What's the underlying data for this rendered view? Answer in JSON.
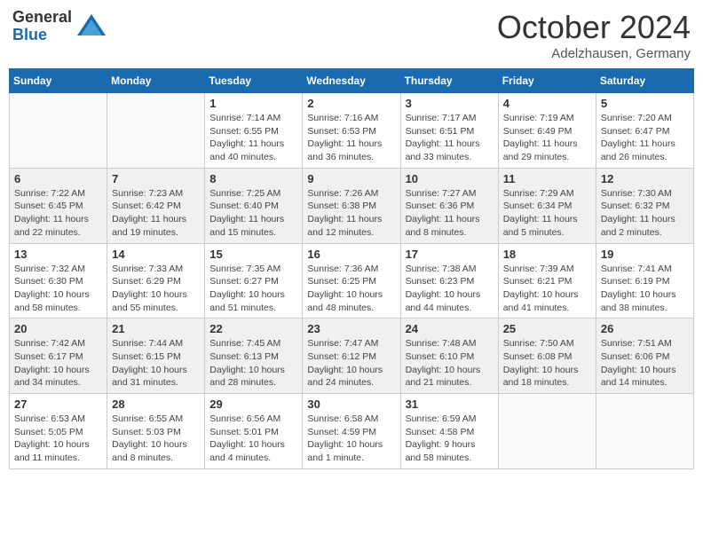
{
  "header": {
    "logo_general": "General",
    "logo_blue": "Blue",
    "month_year": "October 2024",
    "location": "Adelzhausen, Germany"
  },
  "days_of_week": [
    "Sunday",
    "Monday",
    "Tuesday",
    "Wednesday",
    "Thursday",
    "Friday",
    "Saturday"
  ],
  "weeks": [
    [
      {
        "day": "",
        "info": ""
      },
      {
        "day": "",
        "info": ""
      },
      {
        "day": "1",
        "info": "Sunrise: 7:14 AM\nSunset: 6:55 PM\nDaylight: 11 hours and 40 minutes."
      },
      {
        "day": "2",
        "info": "Sunrise: 7:16 AM\nSunset: 6:53 PM\nDaylight: 11 hours and 36 minutes."
      },
      {
        "day": "3",
        "info": "Sunrise: 7:17 AM\nSunset: 6:51 PM\nDaylight: 11 hours and 33 minutes."
      },
      {
        "day": "4",
        "info": "Sunrise: 7:19 AM\nSunset: 6:49 PM\nDaylight: 11 hours and 29 minutes."
      },
      {
        "day": "5",
        "info": "Sunrise: 7:20 AM\nSunset: 6:47 PM\nDaylight: 11 hours and 26 minutes."
      }
    ],
    [
      {
        "day": "6",
        "info": "Sunrise: 7:22 AM\nSunset: 6:45 PM\nDaylight: 11 hours and 22 minutes."
      },
      {
        "day": "7",
        "info": "Sunrise: 7:23 AM\nSunset: 6:42 PM\nDaylight: 11 hours and 19 minutes."
      },
      {
        "day": "8",
        "info": "Sunrise: 7:25 AM\nSunset: 6:40 PM\nDaylight: 11 hours and 15 minutes."
      },
      {
        "day": "9",
        "info": "Sunrise: 7:26 AM\nSunset: 6:38 PM\nDaylight: 11 hours and 12 minutes."
      },
      {
        "day": "10",
        "info": "Sunrise: 7:27 AM\nSunset: 6:36 PM\nDaylight: 11 hours and 8 minutes."
      },
      {
        "day": "11",
        "info": "Sunrise: 7:29 AM\nSunset: 6:34 PM\nDaylight: 11 hours and 5 minutes."
      },
      {
        "day": "12",
        "info": "Sunrise: 7:30 AM\nSunset: 6:32 PM\nDaylight: 11 hours and 2 minutes."
      }
    ],
    [
      {
        "day": "13",
        "info": "Sunrise: 7:32 AM\nSunset: 6:30 PM\nDaylight: 10 hours and 58 minutes."
      },
      {
        "day": "14",
        "info": "Sunrise: 7:33 AM\nSunset: 6:29 PM\nDaylight: 10 hours and 55 minutes."
      },
      {
        "day": "15",
        "info": "Sunrise: 7:35 AM\nSunset: 6:27 PM\nDaylight: 10 hours and 51 minutes."
      },
      {
        "day": "16",
        "info": "Sunrise: 7:36 AM\nSunset: 6:25 PM\nDaylight: 10 hours and 48 minutes."
      },
      {
        "day": "17",
        "info": "Sunrise: 7:38 AM\nSunset: 6:23 PM\nDaylight: 10 hours and 44 minutes."
      },
      {
        "day": "18",
        "info": "Sunrise: 7:39 AM\nSunset: 6:21 PM\nDaylight: 10 hours and 41 minutes."
      },
      {
        "day": "19",
        "info": "Sunrise: 7:41 AM\nSunset: 6:19 PM\nDaylight: 10 hours and 38 minutes."
      }
    ],
    [
      {
        "day": "20",
        "info": "Sunrise: 7:42 AM\nSunset: 6:17 PM\nDaylight: 10 hours and 34 minutes."
      },
      {
        "day": "21",
        "info": "Sunrise: 7:44 AM\nSunset: 6:15 PM\nDaylight: 10 hours and 31 minutes."
      },
      {
        "day": "22",
        "info": "Sunrise: 7:45 AM\nSunset: 6:13 PM\nDaylight: 10 hours and 28 minutes."
      },
      {
        "day": "23",
        "info": "Sunrise: 7:47 AM\nSunset: 6:12 PM\nDaylight: 10 hours and 24 minutes."
      },
      {
        "day": "24",
        "info": "Sunrise: 7:48 AM\nSunset: 6:10 PM\nDaylight: 10 hours and 21 minutes."
      },
      {
        "day": "25",
        "info": "Sunrise: 7:50 AM\nSunset: 6:08 PM\nDaylight: 10 hours and 18 minutes."
      },
      {
        "day": "26",
        "info": "Sunrise: 7:51 AM\nSunset: 6:06 PM\nDaylight: 10 hours and 14 minutes."
      }
    ],
    [
      {
        "day": "27",
        "info": "Sunrise: 6:53 AM\nSunset: 5:05 PM\nDaylight: 10 hours and 11 minutes."
      },
      {
        "day": "28",
        "info": "Sunrise: 6:55 AM\nSunset: 5:03 PM\nDaylight: 10 hours and 8 minutes."
      },
      {
        "day": "29",
        "info": "Sunrise: 6:56 AM\nSunset: 5:01 PM\nDaylight: 10 hours and 4 minutes."
      },
      {
        "day": "30",
        "info": "Sunrise: 6:58 AM\nSunset: 4:59 PM\nDaylight: 10 hours and 1 minute."
      },
      {
        "day": "31",
        "info": "Sunrise: 6:59 AM\nSunset: 4:58 PM\nDaylight: 9 hours and 58 minutes."
      },
      {
        "day": "",
        "info": ""
      },
      {
        "day": "",
        "info": ""
      }
    ]
  ]
}
